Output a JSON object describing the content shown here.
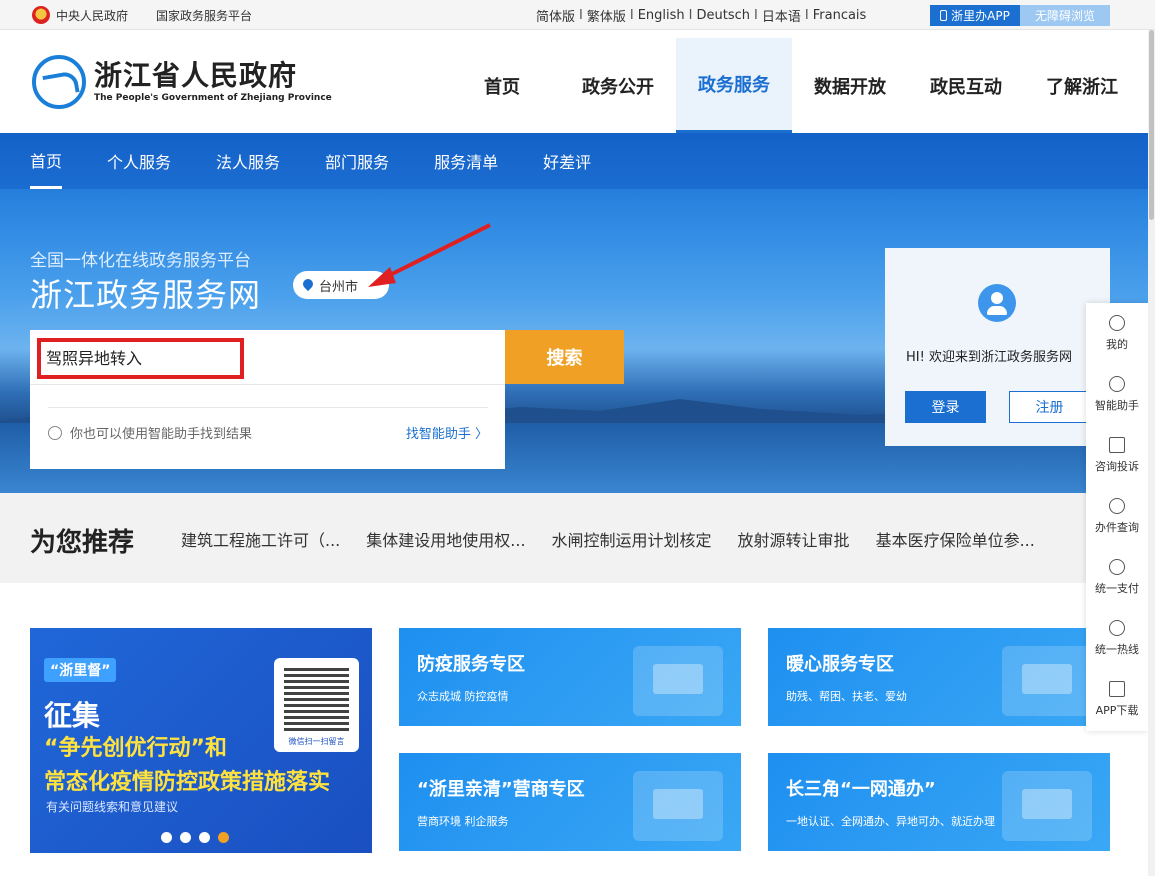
{
  "topbar": {
    "gov_link": "中央人民政府",
    "service_link": "国家政务服务平台",
    "languages": [
      "简体版",
      "繁体版",
      "English",
      "Deutsch",
      "日本语",
      "Francais"
    ],
    "separator": "I",
    "app_button": "浙里办APP",
    "accessible_button": "无障碍浏览"
  },
  "header": {
    "logo_cn": "浙江省人民政府",
    "logo_en": "The People's Government of Zhejiang Province",
    "nav": [
      "首页",
      "政务公开",
      "政务服务",
      "数据开放",
      "政民互动",
      "了解浙江"
    ],
    "active_nav": 2
  },
  "subnav": {
    "items": [
      "首页",
      "个人服务",
      "法人服务",
      "部门服务",
      "服务清单",
      "好差评"
    ],
    "active": 0
  },
  "hero": {
    "subtitle": "全国一体化在线政务服务平台",
    "title": "浙江政务服务网",
    "city": "台州市"
  },
  "search": {
    "value": "驾照异地转入",
    "button": "搜索",
    "hint": "你也可以使用智能助手找到结果",
    "assistant_link": "找智能助手 〉"
  },
  "welcome": {
    "message": "HI! 欢迎来到浙江政务服务网",
    "login": "登录",
    "register": "注册"
  },
  "recommend": {
    "title": "为您推荐",
    "items": [
      "建筑工程施工许可（...",
      "集体建设用地使用权...",
      "水闸控制运用计划核定",
      "放射源转让审批",
      "基本医疗保险单位参..."
    ]
  },
  "banner": {
    "tag": "“浙里督”",
    "line1": "征集",
    "line2": "“争先创优行动”和",
    "line3": "常态化疫情防控政策措施落实",
    "line4": "有关问题线索和意见建议",
    "qr_caption": "微信扫一扫留言",
    "slides": 4,
    "active_slide": 3
  },
  "tiles": [
    {
      "title": "防疫服务专区",
      "subtitle": "众志成城 防控疫情"
    },
    {
      "title": "暖心服务专区",
      "subtitle": "助残、帮困、扶老、爱幼"
    },
    {
      "title": "“浙里亲清”营商专区",
      "subtitle": "营商环境 利企服务"
    },
    {
      "title": "长三角“一网通办”",
      "subtitle": "一地认证、全网通办、异地可办、就近办理"
    }
  ],
  "sidepanel": {
    "items": [
      {
        "label": "我的",
        "icon": "user-icon"
      },
      {
        "label": "智能助手",
        "icon": "headset-icon"
      },
      {
        "label": "咨询投诉",
        "icon": "shield-alert-icon"
      },
      {
        "label": "办件查询",
        "icon": "history-icon"
      },
      {
        "label": "统一支付",
        "icon": "yuan-icon"
      },
      {
        "label": "统一热线",
        "icon": "phone-icon"
      },
      {
        "label": "APP下载",
        "icon": "download-icon"
      }
    ]
  },
  "colors": {
    "primary": "#1a6fd1",
    "search_button": "#f0a024",
    "annotation": "#e02020"
  }
}
